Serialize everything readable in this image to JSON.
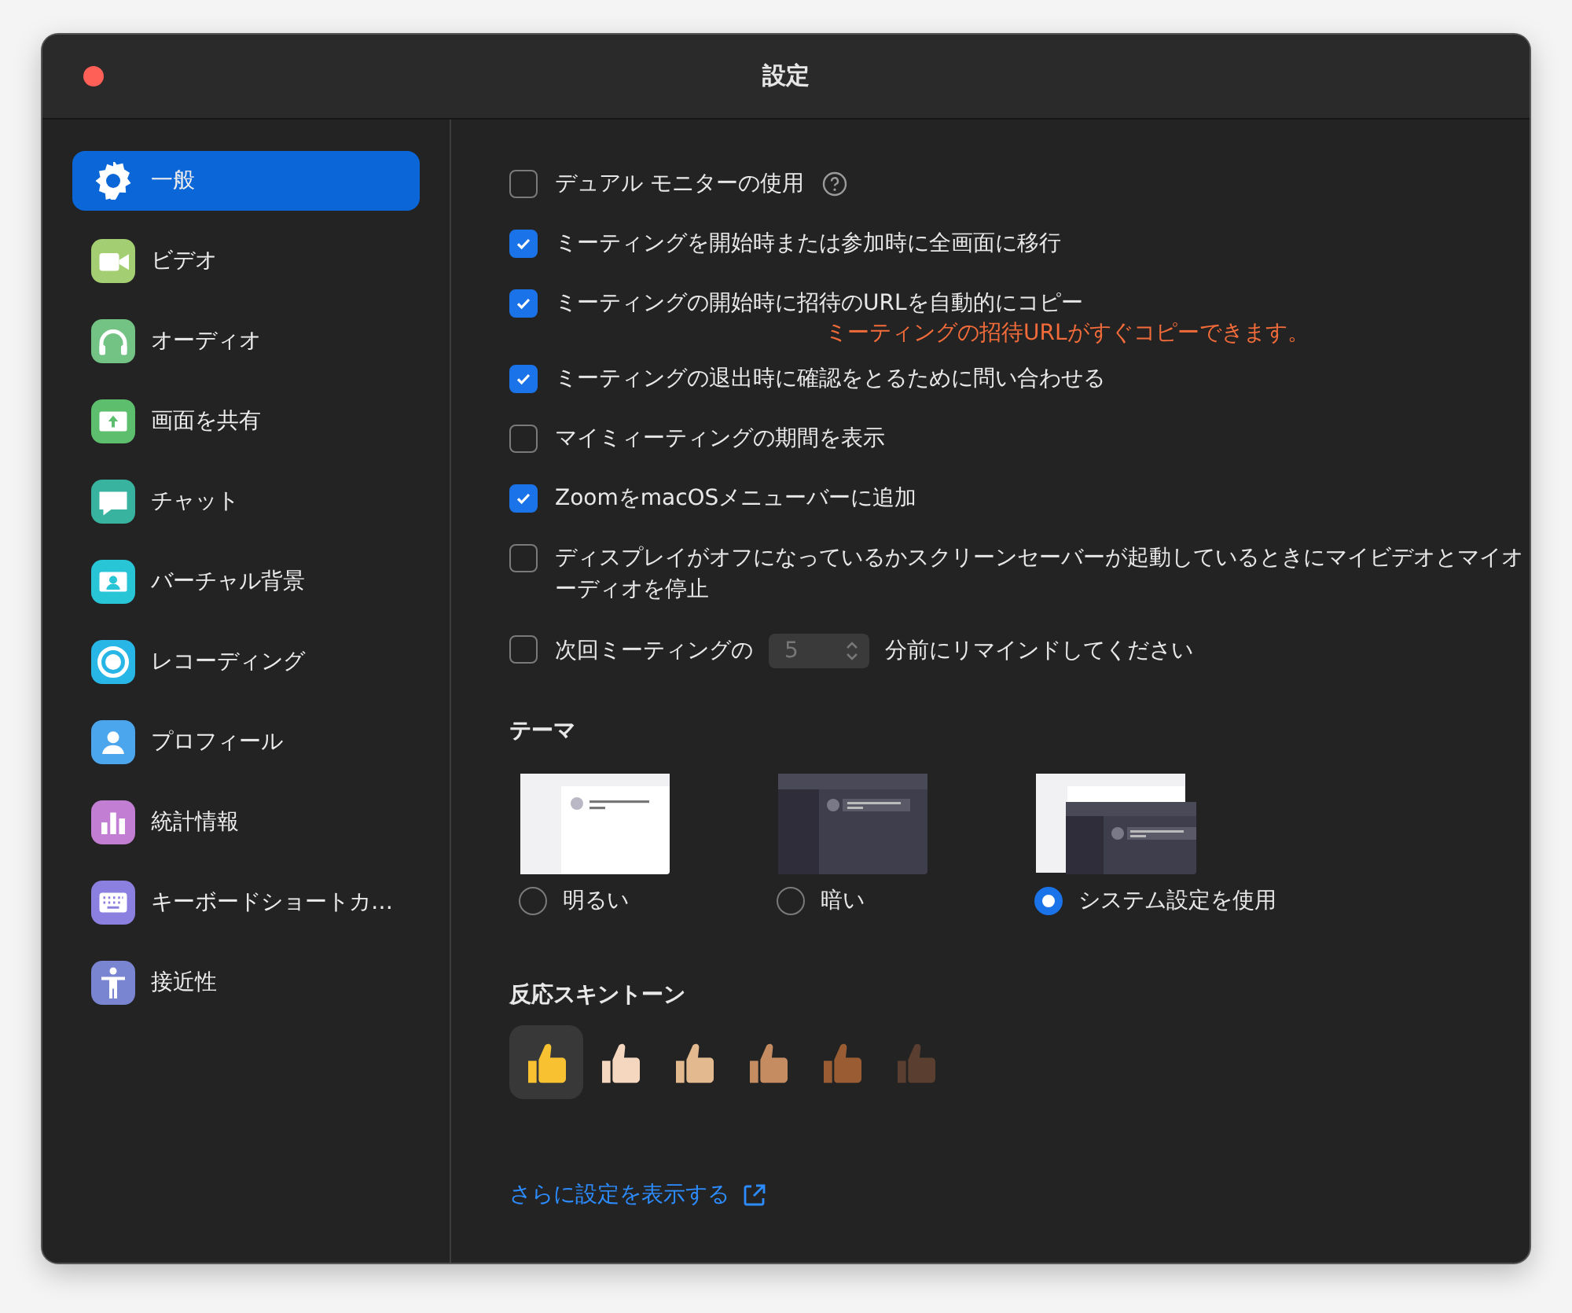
{
  "window": {
    "title": "設定"
  },
  "sidebar": {
    "items": [
      {
        "label": "一般",
        "selected": true
      },
      {
        "label": "ビデオ",
        "selected": false,
        "color": "#a3cf72"
      },
      {
        "label": "オーディオ",
        "selected": false,
        "color": "#72c384"
      },
      {
        "label": "画面を共有",
        "selected": false,
        "color": "#5dbf6e"
      },
      {
        "label": "チャット",
        "selected": false,
        "color": "#38b3a0"
      },
      {
        "label": "バーチャル背景",
        "selected": false,
        "color": "#27c5d6"
      },
      {
        "label": "レコーディング",
        "selected": false,
        "color": "#27b6e6"
      },
      {
        "label": "プロフィール",
        "selected": false,
        "color": "#4ba6ee"
      },
      {
        "label": "統計情報",
        "selected": false,
        "color": "#c27ed3"
      },
      {
        "label": "キーボードショートカ…",
        "selected": false,
        "color": "#8b7fdf"
      },
      {
        "label": "接近性",
        "selected": false,
        "color": "#7a85d2"
      }
    ]
  },
  "settings": [
    {
      "kind": "help",
      "label": "デュアル モニターの使用",
      "checked": false
    },
    {
      "kind": "plain",
      "label": "ミーティングを開始時または参加時に全画面に移行",
      "checked": true
    },
    {
      "kind": "note",
      "label": "ミーティングの開始時に招待のURLを自動的にコピー",
      "note": "ミーティングの招待URLがすぐコピーできます。",
      "checked": true
    },
    {
      "kind": "plain",
      "label": "ミーティングの退出時に確認をとるために問い合わせる",
      "checked": true
    },
    {
      "kind": "plain",
      "label": "マイミィーティングの期間を表示",
      "checked": false
    },
    {
      "kind": "plain",
      "label": "ZoomをmacOSメニューバーに追加",
      "checked": true
    },
    {
      "kind": "plain",
      "label": "ディスプレイがオフになっているかスクリーンセーバーが起動しているときにマイビデオとマイオーディオを停止",
      "checked": false
    },
    {
      "kind": "reminder",
      "label": "次回ミーティングの",
      "value": "5",
      "label_after": "分前にリマインドしてください",
      "checked": false,
      "disabled": true
    }
  ],
  "theme": {
    "heading": "テーマ",
    "options": [
      {
        "kind": "light",
        "label": "明るい",
        "selected": false
      },
      {
        "kind": "dark",
        "label": "暗い",
        "selected": false
      },
      {
        "kind": "system",
        "label": "システム設定を使用",
        "selected": true
      }
    ]
  },
  "skin_tone": {
    "heading": "反応スキントーン",
    "tones": [
      {
        "color": "#f7c132",
        "selected": true
      },
      {
        "color": "#f5d7c0",
        "selected": false
      },
      {
        "color": "#e3b98f",
        "selected": false
      },
      {
        "color": "#c58c62",
        "selected": false
      },
      {
        "color": "#9a5d33",
        "selected": false
      },
      {
        "color": "#5a3e30",
        "selected": false
      }
    ]
  },
  "more_link": "さらに設定を表示する"
}
